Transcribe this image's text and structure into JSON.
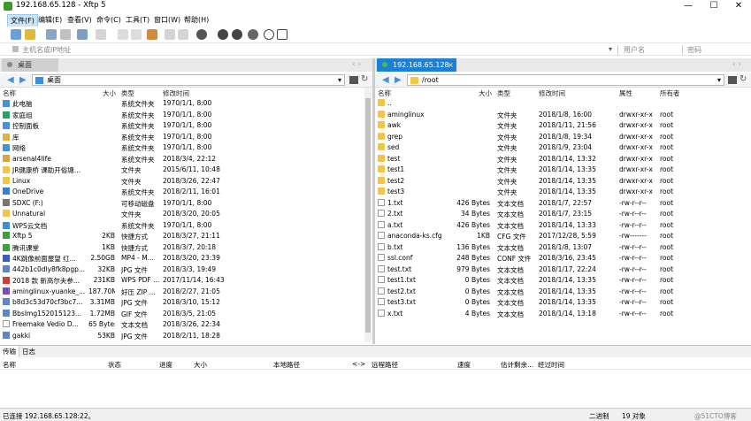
{
  "window": {
    "title": "192.168.65.128    - Xftp 5",
    "minimize": "—",
    "maximize": "☐",
    "close": "✕"
  },
  "menu": [
    "文件(F)",
    "编辑(E)",
    "查看(V)",
    "命令(C)",
    "工具(T)",
    "窗口(W)",
    "帮助(H)"
  ],
  "address": {
    "host_placeholder": "主机名或IP地址",
    "user_placeholder": "用户名",
    "pass_placeholder": "密码"
  },
  "left": {
    "tab": "桌面",
    "path": "桌面",
    "columns": {
      "name": "名称",
      "size": "大小",
      "type": "类型",
      "modified": "修改时间"
    },
    "rows": [
      {
        "name": "此电脑",
        "size": "",
        "type": "系统文件夹",
        "modified": "1970/1/1, 8:00",
        "icon": "pc-icon"
      },
      {
        "name": "家庭组",
        "size": "",
        "type": "系统文件夹",
        "modified": "1970/1/1, 8:00",
        "icon": "homegroup-icon"
      },
      {
        "name": "控制面板",
        "size": "",
        "type": "系统文件夹",
        "modified": "1970/1/1, 8:00",
        "icon": "control-panel-icon"
      },
      {
        "name": "库",
        "size": "",
        "type": "系统文件夹",
        "modified": "1970/1/1, 8:00",
        "icon": "library-icon"
      },
      {
        "name": "网络",
        "size": "",
        "type": "系统文件夹",
        "modified": "1970/1/1, 8:00",
        "icon": "network-icon"
      },
      {
        "name": "arsenal4life",
        "size": "",
        "type": "系统文件夹",
        "modified": "2018/3/4, 22:12",
        "icon": "user-icon"
      },
      {
        "name": "JR健康桥 课助开俗塘...",
        "size": "",
        "type": "文件夹",
        "modified": "2015/6/11, 10:48",
        "icon": "folder-icon"
      },
      {
        "name": "Linux",
        "size": "",
        "type": "文件夹",
        "modified": "2018/3/26, 22:47",
        "icon": "folder-icon"
      },
      {
        "name": "OneDrive",
        "size": "",
        "type": "系统文件夹",
        "modified": "2018/2/11, 16:01",
        "icon": "onedrive-icon"
      },
      {
        "name": "SDXC (F:)",
        "size": "",
        "type": "可移动磁盘",
        "modified": "1970/1/1, 8:00",
        "icon": "drive-icon"
      },
      {
        "name": "Unnatural",
        "size": "",
        "type": "文件夹",
        "modified": "2018/3/20, 20:05",
        "icon": "folder-icon"
      },
      {
        "name": "WPS云文档",
        "size": "",
        "type": "系统文件夹",
        "modified": "1970/1/1, 8:00",
        "icon": "cloud-icon"
      },
      {
        "name": "Xftp 5",
        "size": "2KB",
        "type": "快捷方式",
        "modified": "2018/3/27, 21:11",
        "icon": "shortcut-icon"
      },
      {
        "name": "腾讯课堂",
        "size": "1KB",
        "type": "快捷方式",
        "modified": "2018/3/7, 20:18",
        "icon": "shortcut-icon"
      },
      {
        "name": "4K跳像前面屋望   红...",
        "size": "2.50GB",
        "type": "MP4 - M...",
        "modified": "2018/3/20, 23:39",
        "icon": "video-icon"
      },
      {
        "name": "442b1c0dly8fk8pgp...",
        "size": "32KB",
        "type": "JPG 文件",
        "modified": "2018/3/3, 19:49",
        "icon": "image-icon"
      },
      {
        "name": "2018 款 新高尔夫参...",
        "size": "231KB",
        "type": "WPS PDF ...",
        "modified": "2017/11/14, 16:43",
        "icon": "pdf-icon"
      },
      {
        "name": "aminglinux-yuanke_...",
        "size": "187.70MB",
        "type": "好压 ZIP ...",
        "modified": "2018/2/27, 21:05",
        "icon": "zip-icon"
      },
      {
        "name": "b8d3c53d70cf3bc7...",
        "size": "3.31MB",
        "type": "JPG 文件",
        "modified": "2018/3/10, 15:12",
        "icon": "image-icon"
      },
      {
        "name": "BbsImg152015123...",
        "size": "1.72MB",
        "type": "GIF 文件",
        "modified": "2018/3/5, 21:05",
        "icon": "image-icon"
      },
      {
        "name": "Freemake Vedio D...",
        "size": "65 Bytes",
        "type": "文本文档",
        "modified": "2018/3/26, 22:34",
        "icon": "text-file-icon"
      },
      {
        "name": "gakki",
        "size": "53KB",
        "type": "JPG 文件",
        "modified": "2018/2/11, 18:28",
        "icon": "image-icon"
      }
    ]
  },
  "right": {
    "tab": "192.168.65.128",
    "path": "/root",
    "columns": {
      "name": "名称",
      "size": "大小",
      "type": "类型",
      "modified": "修改时间",
      "attr": "属性",
      "owner": "所有者"
    },
    "rows": [
      {
        "name": "..",
        "size": "",
        "type": "",
        "modified": "",
        "attr": "",
        "owner": "",
        "icon": "folder-icon"
      },
      {
        "name": "aminglinux",
        "size": "",
        "type": "文件夹",
        "modified": "2018/1/8, 16:00",
        "attr": "drwxr-xr-x",
        "owner": "root",
        "icon": "folder-icon"
      },
      {
        "name": "awk",
        "size": "",
        "type": "文件夹",
        "modified": "2018/1/11, 21:56",
        "attr": "drwxr-xr-x",
        "owner": "root",
        "icon": "folder-icon"
      },
      {
        "name": "grep",
        "size": "",
        "type": "文件夹",
        "modified": "2018/1/8, 19:34",
        "attr": "drwxr-xr-x",
        "owner": "root",
        "icon": "folder-icon"
      },
      {
        "name": "sed",
        "size": "",
        "type": "文件夹",
        "modified": "2018/1/9, 23:04",
        "attr": "drwxr-xr-x",
        "owner": "root",
        "icon": "folder-icon"
      },
      {
        "name": "test",
        "size": "",
        "type": "文件夹",
        "modified": "2018/1/14, 13:32",
        "attr": "drwxr-xr-x",
        "owner": "root",
        "icon": "folder-icon"
      },
      {
        "name": "test1",
        "size": "",
        "type": "文件夹",
        "modified": "2018/1/14, 13:35",
        "attr": "drwxr-xr-x",
        "owner": "root",
        "icon": "folder-icon"
      },
      {
        "name": "test2",
        "size": "",
        "type": "文件夹",
        "modified": "2018/1/14, 13:35",
        "attr": "drwxr-xr-x",
        "owner": "root",
        "icon": "folder-icon"
      },
      {
        "name": "test3",
        "size": "",
        "type": "文件夹",
        "modified": "2018/1/14, 13:35",
        "attr": "drwxr-xr-x",
        "owner": "root",
        "icon": "folder-icon"
      },
      {
        "name": "1.txt",
        "size": "426 Bytes",
        "type": "文本文档",
        "modified": "2018/1/7, 22:57",
        "attr": "-rw-r--r--",
        "owner": "root",
        "icon": "text-file-icon"
      },
      {
        "name": "2.txt",
        "size": "34 Bytes",
        "type": "文本文档",
        "modified": "2018/1/7, 23:15",
        "attr": "-rw-r--r--",
        "owner": "root",
        "icon": "text-file-icon"
      },
      {
        "name": "a.txt",
        "size": "426 Bytes",
        "type": "文本文档",
        "modified": "2018/1/14, 13:33",
        "attr": "-rw-r--r--",
        "owner": "root",
        "icon": "text-file-icon"
      },
      {
        "name": "anaconda-ks.cfg",
        "size": "1KB",
        "type": "CFG 文件",
        "modified": "2017/12/28, 5:59",
        "attr": "-rw-------",
        "owner": "root",
        "icon": "text-file-icon"
      },
      {
        "name": "b.txt",
        "size": "136 Bytes",
        "type": "文本文档",
        "modified": "2018/1/8, 13:07",
        "attr": "-rw-r--r--",
        "owner": "root",
        "icon": "text-file-icon"
      },
      {
        "name": "ssl.conf",
        "size": "248 Bytes",
        "type": "CONF 文件",
        "modified": "2018/3/16, 23:45",
        "attr": "-rw-r--r--",
        "owner": "root",
        "icon": "text-file-icon"
      },
      {
        "name": "test.txt",
        "size": "979 Bytes",
        "type": "文本文档",
        "modified": "2018/1/17, 22:24",
        "attr": "-rw-r--r--",
        "owner": "root",
        "icon": "text-file-icon"
      },
      {
        "name": "test1.txt",
        "size": "0 Bytes",
        "type": "文本文档",
        "modified": "2018/1/14, 13:35",
        "attr": "-rw-r--r--",
        "owner": "root",
        "icon": "text-file-icon"
      },
      {
        "name": "test2.txt",
        "size": "0 Bytes",
        "type": "文本文档",
        "modified": "2018/1/14, 13:35",
        "attr": "-rw-r--r--",
        "owner": "root",
        "icon": "text-file-icon"
      },
      {
        "name": "test3.txt",
        "size": "0 Bytes",
        "type": "文本文档",
        "modified": "2018/1/14, 13:35",
        "attr": "-rw-r--r--",
        "owner": "root",
        "icon": "text-file-icon"
      },
      {
        "name": "x.txt",
        "size": "4 Bytes",
        "type": "文本文档",
        "modified": "2018/1/14, 13:18",
        "attr": "-rw-r--r--",
        "owner": "root",
        "icon": "text-file-icon"
      }
    ]
  },
  "transfer": {
    "tabs": [
      "传输",
      "日志"
    ],
    "columns": [
      "名称",
      "状态",
      "进度",
      "大小",
      "本地路径",
      "<->",
      "远程路径",
      "速度",
      "估计剩余...",
      "经过时间"
    ]
  },
  "status": {
    "left": "已连接 192.168.65.128:22。",
    "mode": "二进制",
    "count": "19 对象",
    "watermark": "@51CTO博客"
  },
  "colors": {
    "accent": "#1e7fd6",
    "folder": "#f5c542"
  }
}
